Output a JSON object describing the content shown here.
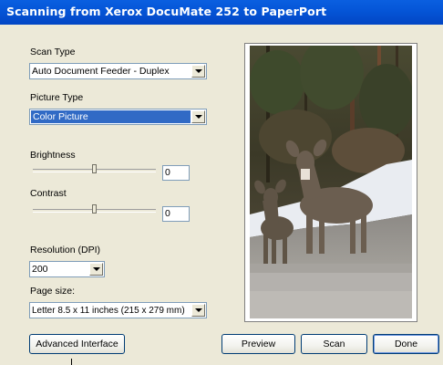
{
  "window": {
    "title": "Scanning from Xerox DocuMate 252 to PaperPort"
  },
  "scan_type": {
    "label": "Scan Type",
    "value": "Auto Document Feeder - Duplex"
  },
  "picture_type": {
    "label": "Picture Type",
    "value": "Color Picture"
  },
  "brightness": {
    "label": "Brightness",
    "value": "0",
    "level": 0.5
  },
  "contrast": {
    "label": "Contrast",
    "value": "0",
    "level": 0.5
  },
  "resolution": {
    "label": "Resolution (DPI)",
    "value": "200"
  },
  "page_size": {
    "label": "Page size:",
    "value": "Letter 8.5 x 11 inches (215 x 279 mm)"
  },
  "buttons": {
    "advanced": "Advanced Interface",
    "preview": "Preview",
    "scan": "Scan",
    "done": "Done"
  },
  "colors": {
    "titlebar": "#0555d6",
    "face": "#ece9d8",
    "selection": "#316ac5"
  }
}
